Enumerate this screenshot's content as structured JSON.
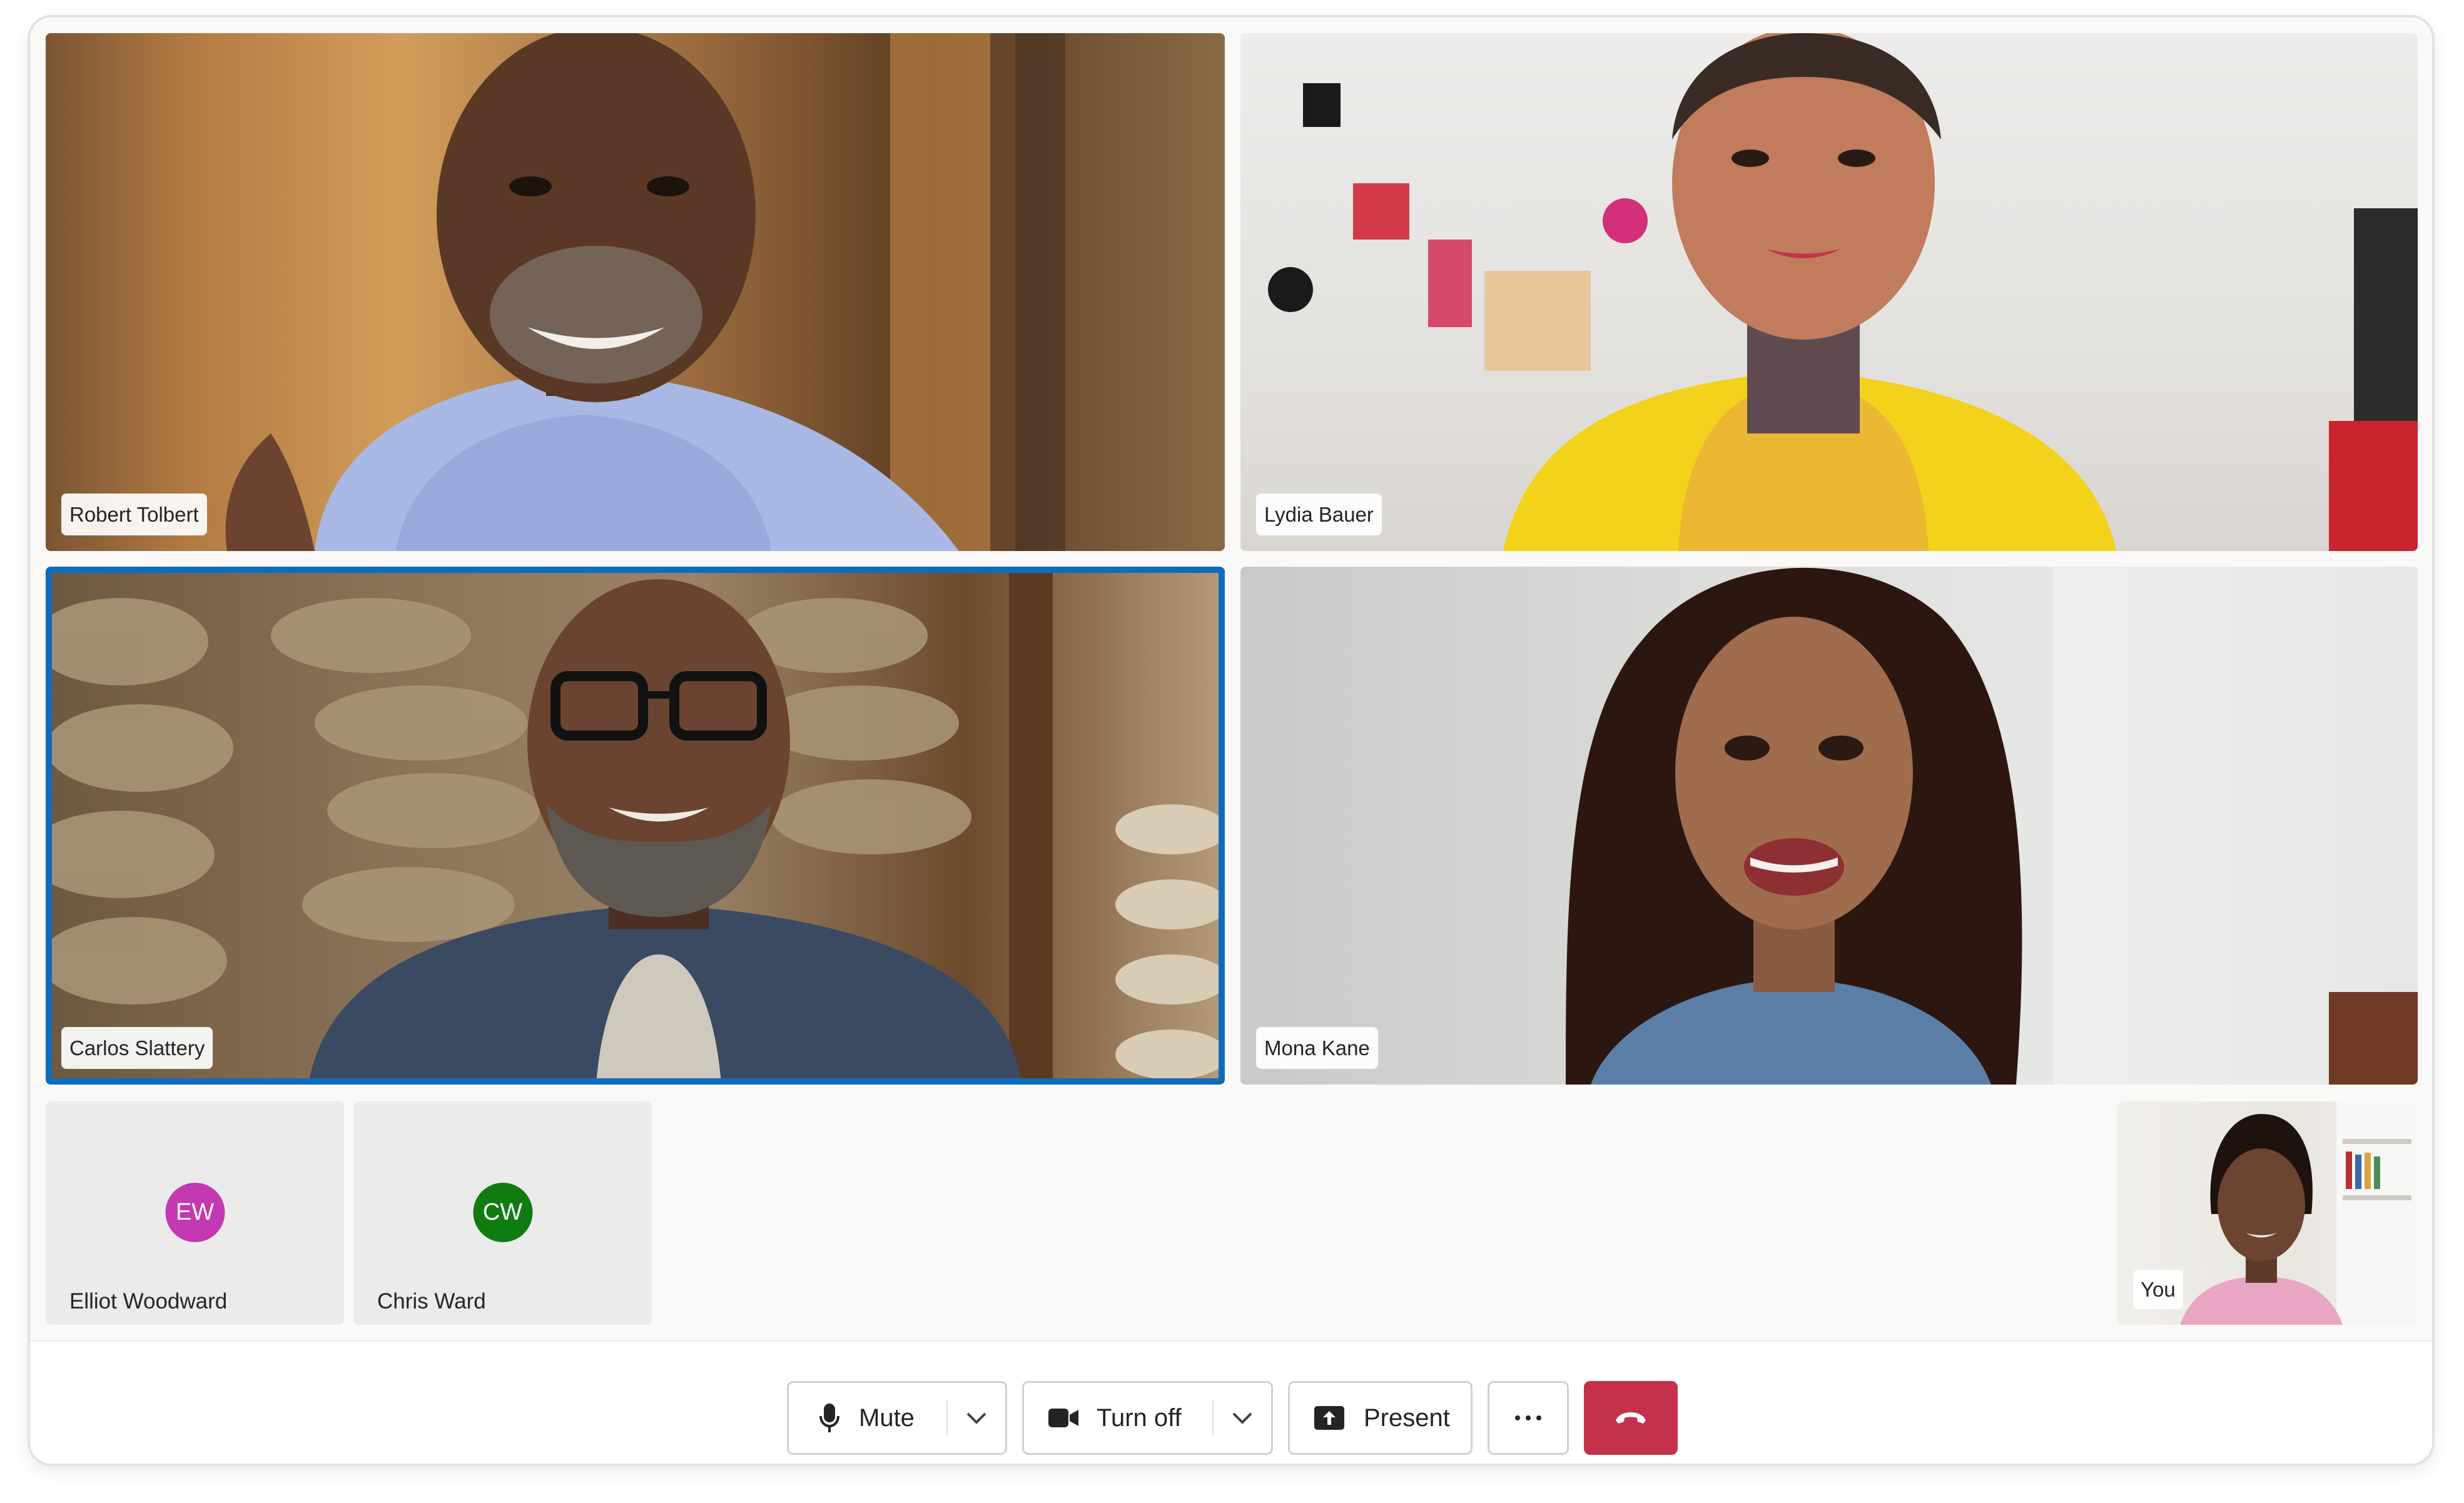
{
  "participants": {
    "robert": {
      "name": "Robert Tolbert"
    },
    "lydia": {
      "name": "Lydia Bauer"
    },
    "carlos": {
      "name": "Carlos Slattery"
    },
    "mona": {
      "name": "Mona Kane"
    },
    "elliot": {
      "name": "Elliot Woodward",
      "initials": "EW",
      "color": "#c239b3"
    },
    "chris": {
      "name": "Chris Ward",
      "initials": "CW",
      "color": "#107c10"
    },
    "self": {
      "name": "You"
    }
  },
  "controls": {
    "mute_label": "Mute",
    "camera_label": "Turn off",
    "present_label": "Present",
    "more_icon": "more-icon",
    "leave_icon": "hang-up-icon"
  },
  "colors": {
    "active_speaker": "#0f6cbd",
    "leave_button": "#c4314b"
  }
}
